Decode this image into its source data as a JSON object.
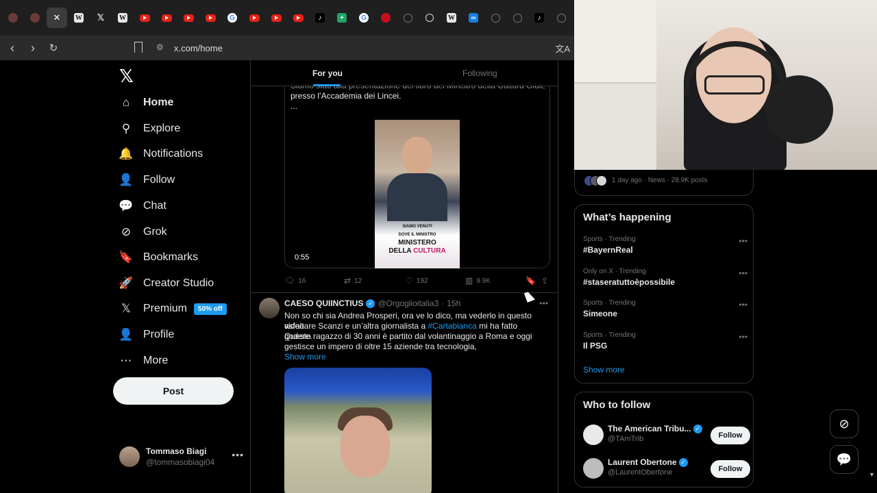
{
  "browser": {
    "tabs": [
      {
        "icon": "avatar-favicon",
        "label": ""
      },
      {
        "icon": "avatar-favicon",
        "label": ""
      },
      {
        "icon": "close-icon",
        "label": "✕",
        "active": true
      },
      {
        "icon": "wikipedia-icon",
        "label": "W"
      },
      {
        "icon": "x-icon",
        "label": "𝕏"
      },
      {
        "icon": "wikipedia-icon",
        "label": "W"
      },
      {
        "icon": "youtube-icon",
        "label": ""
      },
      {
        "icon": "youtube-icon",
        "label": ""
      },
      {
        "icon": "youtube-icon",
        "label": ""
      },
      {
        "icon": "youtube-icon",
        "label": ""
      },
      {
        "icon": "google-icon",
        "label": "G"
      },
      {
        "icon": "youtube-icon",
        "label": ""
      },
      {
        "icon": "youtube-icon",
        "label": ""
      },
      {
        "icon": "youtube-icon",
        "label": ""
      },
      {
        "icon": "tiktok-icon",
        "label": "♪"
      },
      {
        "icon": "sheets-icon",
        "label": "+"
      },
      {
        "icon": "google-icon",
        "label": "G"
      },
      {
        "icon": "red-circle-icon",
        "label": ""
      },
      {
        "icon": "globe-icon",
        "label": ""
      },
      {
        "icon": "grok-icon",
        "label": ""
      },
      {
        "icon": "wikipedia-icon",
        "label": "W"
      },
      {
        "icon": "blue-app-icon",
        "label": "∞"
      },
      {
        "icon": "globe-icon",
        "label": ""
      },
      {
        "icon": "globe-icon",
        "label": ""
      },
      {
        "icon": "tiktok-icon",
        "label": "♪"
      },
      {
        "icon": "globe-icon",
        "label": ""
      }
    ],
    "url": "x.com/home"
  },
  "nav": {
    "items": [
      {
        "label": "Home",
        "icon": "home-icon",
        "glyph": "⌂"
      },
      {
        "label": "Explore",
        "icon": "search-icon",
        "glyph": "⚲"
      },
      {
        "label": "Notifications",
        "icon": "bell-icon",
        "glyph": "🔔"
      },
      {
        "label": "Follow",
        "icon": "add-person-icon",
        "glyph": "👤"
      },
      {
        "label": "Chat",
        "icon": "chat-icon",
        "glyph": "💬"
      },
      {
        "label": "Grok",
        "icon": "grok-icon",
        "glyph": "⊘"
      },
      {
        "label": "Bookmarks",
        "icon": "bookmark-icon",
        "glyph": "🔖"
      },
      {
        "label": "Creator Studio",
        "icon": "rocket-icon",
        "glyph": "🚀"
      },
      {
        "label": "Premium",
        "icon": "x-logo-icon",
        "glyph": "𝕏"
      },
      {
        "label": "Profile",
        "icon": "person-icon",
        "glyph": "👤"
      },
      {
        "label": "More",
        "icon": "more-circle-icon",
        "glyph": "⋯"
      }
    ],
    "premium_badge": "50% off",
    "post_label": "Post",
    "user": {
      "name": "Tommaso Biagi",
      "handle": "@tommasobiagi04"
    }
  },
  "timeline": {
    "tabs": [
      "For you",
      "Following"
    ],
    "tweet1": {
      "text_line1": "Siamo stati alla presentazione del libro del Ministro della Cultura Giuli,",
      "text_line2": "presso l’Accademia dei Lincei.",
      "text_line3": "...",
      "sign_line1": "SIAMO VENUTI",
      "sign_line2": "DOVE IL MINISTRO",
      "sign_line3": "MINISTERO",
      "sign_line4a": "DELLA ",
      "sign_line4b": "CULTURA",
      "duration": "0:55",
      "replies": "16",
      "reposts": "12",
      "likes": "192",
      "views": "9.9K"
    },
    "tweet2": {
      "name": "CAESO QUIINCTIUS",
      "handle": "@Orgoglioitalia3",
      "time": "15h",
      "line1": "Non so chi sia Andrea Prosperi, ora ve lo dico, ma vederlo in questo video",
      "line2a": "asfaltare Scanzi e un’altra giornalista a ",
      "hashtag": "#Cartabianca",
      "line2b": " mi ha fatto godere.",
      "line3": "Questo ragazzo di 30 anni è partito dal volantinaggio a Roma e oggi",
      "line4": "gestisce un impero di oltre 15 aziende tra tecnologia,",
      "show_more": "Show more"
    }
  },
  "sidebar": {
    "top_info": "1 day ago · News · 28.9K posts",
    "happening_title": "What’s happening",
    "trends": [
      {
        "context": "Sports · Trending",
        "name": "#BayernReal"
      },
      {
        "context": "Only on X · Trending",
        "name": "#staseratuttoèpossibile"
      },
      {
        "context": "Sports · Trending",
        "name": "Simeone"
      },
      {
        "context": "Sports · Trending",
        "name": "Il PSG"
      }
    ],
    "show_more": "Show more",
    "wtf_title": "Who to follow",
    "follow": [
      {
        "name": "The American Tribu...",
        "handle": "@TAmTrib",
        "button": "Follow"
      },
      {
        "name": "Laurent Obertone",
        "handle": "@LaurentObertone",
        "button": "Follow"
      }
    ]
  },
  "colors": {
    "accent": "#1d9bf0",
    "background": "#000000",
    "border": "#2f3336",
    "muted": "#71767b"
  }
}
